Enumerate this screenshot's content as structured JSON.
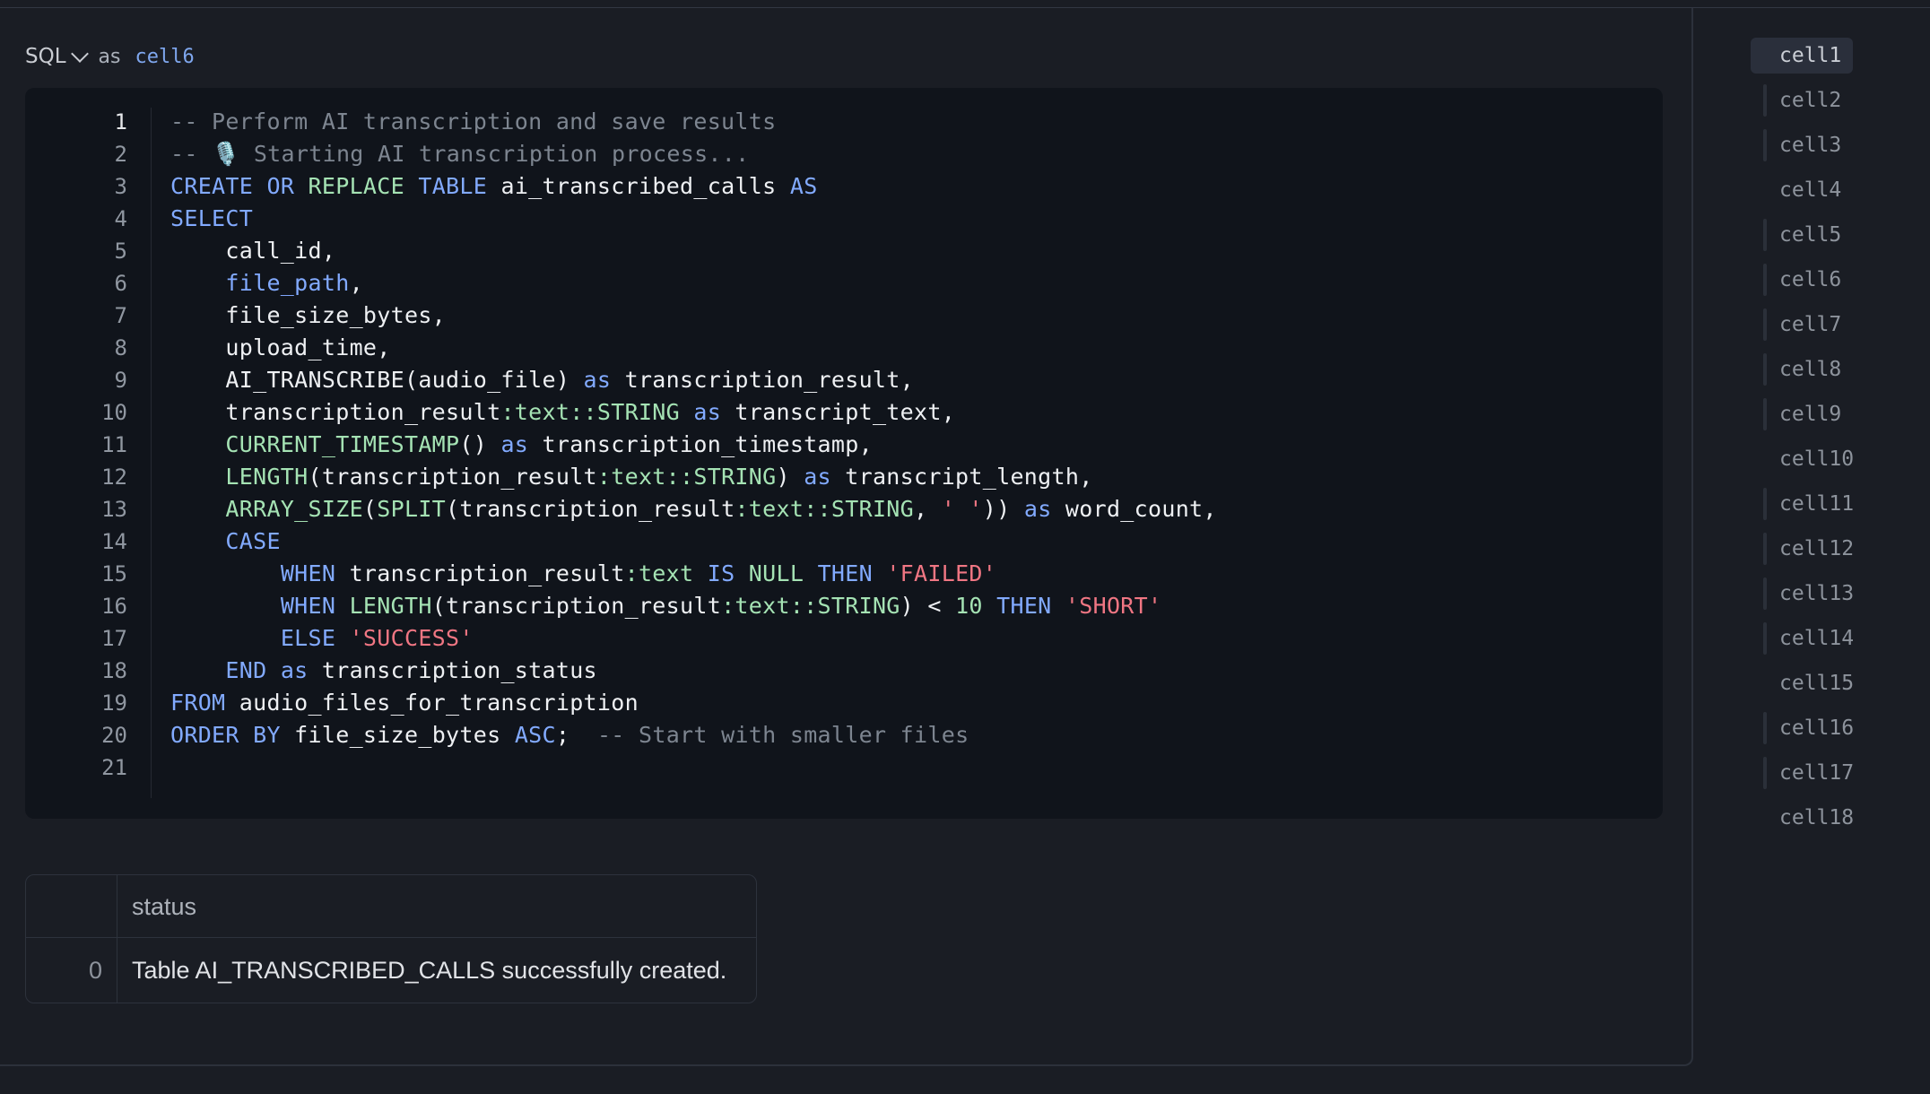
{
  "cell": {
    "language": "SQL",
    "as_label": "as",
    "name": "cell6"
  },
  "editor": {
    "active_line": 1,
    "lines": [
      [
        {
          "t": "cm",
          "v": "-- Perform AI transcription and save results"
        }
      ],
      [
        {
          "t": "cm",
          "v": "-- 🎙️ Starting AI transcription process..."
        }
      ],
      [
        {
          "t": "kw",
          "v": "CREATE"
        },
        {
          "t": "tx",
          "v": " "
        },
        {
          "t": "kw",
          "v": "OR"
        },
        {
          "t": "tx",
          "v": " "
        },
        {
          "t": "fn",
          "v": "REPLACE"
        },
        {
          "t": "tx",
          "v": " "
        },
        {
          "t": "kw",
          "v": "TABLE"
        },
        {
          "t": "tx",
          "v": " ai_transcribed_calls "
        },
        {
          "t": "kw",
          "v": "AS"
        }
      ],
      [
        {
          "t": "kw",
          "v": "SELECT"
        }
      ],
      [
        {
          "t": "tx",
          "v": "    call_id,"
        }
      ],
      [
        {
          "t": "tx",
          "v": "    "
        },
        {
          "t": "kw",
          "v": "file_path"
        },
        {
          "t": "tx",
          "v": ","
        }
      ],
      [
        {
          "t": "tx",
          "v": "    file_size_bytes,"
        }
      ],
      [
        {
          "t": "tx",
          "v": "    upload_time,"
        }
      ],
      [
        {
          "t": "tx",
          "v": "    AI_TRANSCRIBE(audio_file) "
        },
        {
          "t": "kw",
          "v": "as"
        },
        {
          "t": "tx",
          "v": " transcription_result,"
        }
      ],
      [
        {
          "t": "tx",
          "v": "    transcription_result"
        },
        {
          "t": "fn",
          "v": ":text::STRING"
        },
        {
          "t": "tx",
          "v": " "
        },
        {
          "t": "kw",
          "v": "as"
        },
        {
          "t": "tx",
          "v": " transcript_text,"
        }
      ],
      [
        {
          "t": "tx",
          "v": "    "
        },
        {
          "t": "fn",
          "v": "CURRENT_TIMESTAMP"
        },
        {
          "t": "tx",
          "v": "() "
        },
        {
          "t": "kw",
          "v": "as"
        },
        {
          "t": "tx",
          "v": " transcription_timestamp,"
        }
      ],
      [
        {
          "t": "tx",
          "v": "    "
        },
        {
          "t": "fn",
          "v": "LENGTH"
        },
        {
          "t": "tx",
          "v": "(transcription_result"
        },
        {
          "t": "fn",
          "v": ":text::STRING"
        },
        {
          "t": "tx",
          "v": ") "
        },
        {
          "t": "kw",
          "v": "as"
        },
        {
          "t": "tx",
          "v": " transcript_length,"
        }
      ],
      [
        {
          "t": "tx",
          "v": "    "
        },
        {
          "t": "fn",
          "v": "ARRAY_SIZE"
        },
        {
          "t": "tx",
          "v": "("
        },
        {
          "t": "fn",
          "v": "SPLIT"
        },
        {
          "t": "tx",
          "v": "(transcription_result"
        },
        {
          "t": "fn",
          "v": ":text::STRING"
        },
        {
          "t": "tx",
          "v": ", "
        },
        {
          "t": "st",
          "v": "' '"
        },
        {
          "t": "tx",
          "v": ")) "
        },
        {
          "t": "kw",
          "v": "as"
        },
        {
          "t": "tx",
          "v": " word_count,"
        }
      ],
      [
        {
          "t": "tx",
          "v": "    "
        },
        {
          "t": "kw",
          "v": "CASE"
        }
      ],
      [
        {
          "t": "tx",
          "v": "        "
        },
        {
          "t": "kw",
          "v": "WHEN"
        },
        {
          "t": "tx",
          "v": " transcription_result"
        },
        {
          "t": "fn",
          "v": ":text"
        },
        {
          "t": "tx",
          "v": " "
        },
        {
          "t": "kw",
          "v": "IS"
        },
        {
          "t": "tx",
          "v": " "
        },
        {
          "t": "fn",
          "v": "NULL"
        },
        {
          "t": "tx",
          "v": " "
        },
        {
          "t": "kw",
          "v": "THEN"
        },
        {
          "t": "tx",
          "v": " "
        },
        {
          "t": "st",
          "v": "'FAILED'"
        }
      ],
      [
        {
          "t": "tx",
          "v": "        "
        },
        {
          "t": "kw",
          "v": "WHEN"
        },
        {
          "t": "tx",
          "v": " "
        },
        {
          "t": "fn",
          "v": "LENGTH"
        },
        {
          "t": "tx",
          "v": "(transcription_result"
        },
        {
          "t": "fn",
          "v": ":text::STRING"
        },
        {
          "t": "tx",
          "v": ") < "
        },
        {
          "t": "nm",
          "v": "10"
        },
        {
          "t": "tx",
          "v": " "
        },
        {
          "t": "kw",
          "v": "THEN"
        },
        {
          "t": "tx",
          "v": " "
        },
        {
          "t": "st",
          "v": "'SHORT'"
        }
      ],
      [
        {
          "t": "tx",
          "v": "        "
        },
        {
          "t": "kw",
          "v": "ELSE"
        },
        {
          "t": "tx",
          "v": " "
        },
        {
          "t": "st",
          "v": "'SUCCESS'"
        }
      ],
      [
        {
          "t": "tx",
          "v": "    "
        },
        {
          "t": "kw",
          "v": "END"
        },
        {
          "t": "tx",
          "v": " "
        },
        {
          "t": "kw",
          "v": "as"
        },
        {
          "t": "tx",
          "v": " transcription_status"
        }
      ],
      [
        {
          "t": "kw",
          "v": "FROM"
        },
        {
          "t": "tx",
          "v": " audio_files_for_transcription"
        }
      ],
      [
        {
          "t": "kw",
          "v": "ORDER"
        },
        {
          "t": "tx",
          "v": " "
        },
        {
          "t": "kw",
          "v": "BY"
        },
        {
          "t": "tx",
          "v": " file_size_bytes "
        },
        {
          "t": "kw",
          "v": "ASC"
        },
        {
          "t": "tx",
          "v": ";  "
        },
        {
          "t": "cm",
          "v": "-- Start with smaller files"
        }
      ],
      []
    ]
  },
  "result": {
    "columns": [
      "status"
    ],
    "rows": [
      {
        "index": "0",
        "values": [
          "Table AI_TRANSCRIBED_CALLS successfully created."
        ]
      }
    ]
  },
  "outline": {
    "active": "cell1",
    "items": [
      {
        "label": "cell1",
        "bar": false
      },
      {
        "label": "cell2",
        "bar": true
      },
      {
        "label": "cell3",
        "bar": true
      },
      {
        "label": "cell4",
        "bar": false
      },
      {
        "label": "cell5",
        "bar": true
      },
      {
        "label": "cell6",
        "bar": true
      },
      {
        "label": "cell7",
        "bar": true
      },
      {
        "label": "cell8",
        "bar": true
      },
      {
        "label": "cell9",
        "bar": true
      },
      {
        "label": "cell10",
        "bar": false
      },
      {
        "label": "cell11",
        "bar": true
      },
      {
        "label": "cell12",
        "bar": true
      },
      {
        "label": "cell13",
        "bar": true
      },
      {
        "label": "cell14",
        "bar": true
      },
      {
        "label": "cell15",
        "bar": false
      },
      {
        "label": "cell16",
        "bar": true
      },
      {
        "label": "cell17",
        "bar": true
      },
      {
        "label": "cell18",
        "bar": false
      }
    ]
  },
  "colors": {
    "background": "#1a1d24",
    "editor_bg": "#10141b",
    "keyword": "#82aaff",
    "function": "#a5e3b4",
    "string": "#f07683",
    "comment": "#7d8590"
  }
}
